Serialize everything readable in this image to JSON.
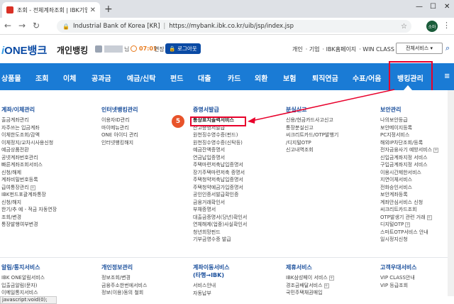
{
  "browser": {
    "tab_title": "조회 - 전체계좌조회 | IBK기업은",
    "url_site": "Industrial Bank of Korea [KR]",
    "url": "https://mybank.ibk.co.kr/uib/jsp/index.jsp",
    "profile_label": "소마",
    "status_text": "javascript:void(0);"
  },
  "header": {
    "logo_text": "ONE뱅크",
    "logo_prefix": "i",
    "section": "개인뱅킹",
    "user_suffix": "님",
    "timer": "07:01",
    "extend": "연장",
    "logout": "로그아웃",
    "top_links": [
      "개인",
      "· 기업",
      "· IBK홈페이지",
      "· WIN CLASS"
    ],
    "all_services": "전체서비스 ▾"
  },
  "nav": {
    "items": [
      "상품몰",
      "조회",
      "이체",
      "공과금",
      "예금/신탁",
      "펀드",
      "대출",
      "카드",
      "외환",
      "보험",
      "퇴직연금",
      "수표/어음",
      "뱅킹관리"
    ],
    "more": "≡"
  },
  "badges": {
    "step4": "4",
    "step5": "5"
  },
  "mega": {
    "col1": {
      "title": "계좌/이체관리",
      "items": [
        "출금계좌관리",
        "자주쓰는 입금계좌",
        "이체한도조회/감액",
        "이체정지/교차시사용신청",
        "예금상품전환",
        "공넷계좌번호관리",
        "빠른계좌조회서비스",
        "신청/해제",
        "계좌비밀번호등록",
        "급여통장관리",
        "IBK펀드포괄계좌통장",
        "신청/해지",
        "한기/추 예 - 적금 자동연장",
        "조회/변경",
        "통장발행여부변경"
      ]
    },
    "col2": {
      "title": "인터넷뱅킹관리",
      "items": [
        "이용자ID관리",
        "마이메뉴관리",
        "ONE 아이디 관리",
        "인터넷뱅킹해지"
      ]
    },
    "col3": {
      "title": "증명서발급",
      "items": [
        "통장표지출력서비스",
        "잔고증명서발급",
        "원천징수영수증(펀드)",
        "원천징수영수증(신탁등)",
        "예금잔액증명서",
        "연금납입증명서",
        "주택마련저축납입증명서",
        "장기주택마련저축 증명서",
        "주택청약저축납입증명서",
        "주택청약예금가입증명서",
        "공인인증서발급확인증",
        "금융거래확인서",
        "부채증명서",
        "대출금증명서(당년)확인서",
        "연체해제(업중)사실확인서",
        "청년희망펀드",
        "기부금영수증 발급"
      ]
    },
    "col4": {
      "title": "분실신고",
      "items": [
        "신용/현금카드사고신고",
        "통장분실신고",
        "씨크리트카드/OTP발행기",
        "/디지털OTP",
        "신고내역조회"
      ]
    },
    "col5": {
      "title": "보안관리",
      "items": [
        "나의보안등급",
        "보안메이지등록",
        "PC지정서비스",
        "해외IP차단조회/등록",
        "전자금융사기 예방서비스",
        "신입금계좌지정 서비스",
        "구입금계좌지정 서비스",
        "이용시간제한서비스",
        "지연이체서비스",
        "전화승인서비스",
        "보안계좌등록",
        "계좌안심서비스 신청",
        "씨크리트카드조회",
        "OTP발생기 관련 거래",
        "디지털OTP",
        "스마트OTP서비스 안내",
        "일시정지신청"
      ]
    },
    "bottom": [
      {
        "title": "알림/통지서비스",
        "items": [
          "IBK ONE알림서비스",
          "입출금알림(문자)",
          "이메일통지서비스"
        ]
      },
      {
        "title": "개인정보관리",
        "items": [
          "정보조회/변경",
          "금융주소한번에서비스",
          "정보(이용)동의 철회"
        ]
      },
      {
        "title": "계좌이동서비스",
        "title2": "(타행→IBK)",
        "items": [
          "서비스안내",
          "자동납부"
        ]
      },
      {
        "title": "제휴서비스",
        "items": [
          "IBK삼성페이 서비스",
          "경조금배달서비스",
          "국민주택채권매입"
        ]
      },
      {
        "title": "고객우대서비스",
        "items": [
          "VIP CLASS안내",
          "VIP 등급조회"
        ]
      }
    ]
  },
  "colors": {
    "brand_blue": "#1a7bd5",
    "highlight_red": "#e8002b",
    "badge_orange": "#e8532a"
  }
}
